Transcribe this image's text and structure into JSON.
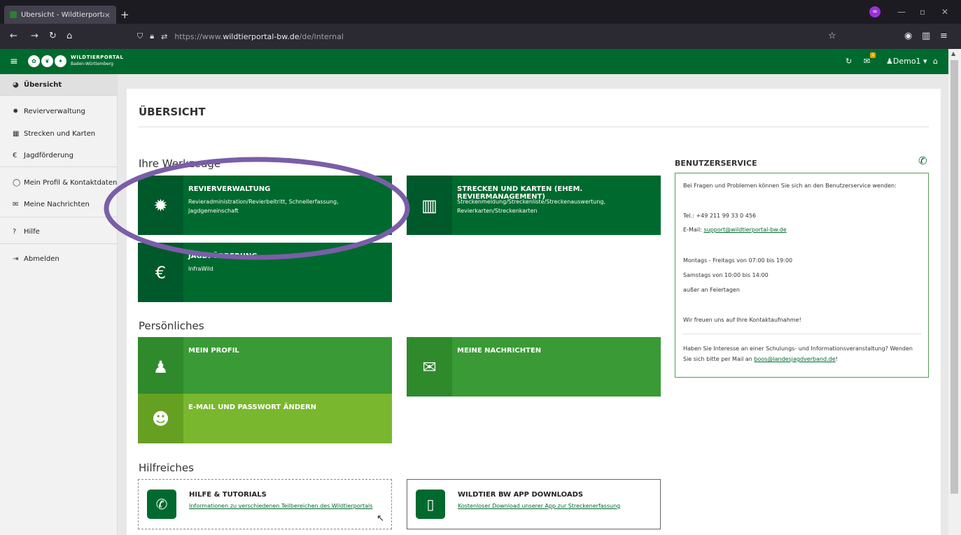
{
  "browser": {
    "tab_title": "Übersicht - Wildtierportal",
    "tab_close": "×",
    "new_tab": "+",
    "url_dim_prefix": "https://www.",
    "url_domain": "wildtierportal-bw.de",
    "url_path": "/de/internal",
    "private_icon": "∞"
  },
  "header": {
    "logo_line1": "WILDTIERPORTAL",
    "logo_line2": "Baden-Württemberg",
    "notif_count": "1",
    "user": "Demo1"
  },
  "sidebar": {
    "items": [
      {
        "label": "Übersicht",
        "icon": "dashboard-icon"
      },
      {
        "label": "Revierverwaltung",
        "icon": "gear-icon"
      },
      {
        "label": "Strecken und Karten",
        "icon": "map-icon"
      },
      {
        "label": "Jagdförderung",
        "icon": "euro-icon"
      },
      {
        "label": "Mein Profil & Kontaktdaten",
        "icon": "user-circle-icon"
      },
      {
        "label": "Meine Nachrichten",
        "icon": "envelope-icon"
      },
      {
        "label": "Hilfe",
        "icon": "question-icon"
      },
      {
        "label": "Abmelden",
        "icon": "sign-out-icon"
      }
    ]
  },
  "main": {
    "title": "ÜBERSICHT",
    "sections": {
      "tools": "Ihre Werkzeuge",
      "personal": "Persönliches",
      "helpful": "Hilfreiches"
    },
    "tiles": [
      {
        "title": "REVIERVERWALTUNG",
        "subtitle": "Revieradministration/Revierbeitritt, Schnellerfassung, Jagdgemeinschaft"
      },
      {
        "title": "STRECKEN UND KARTEN (EHEM. REVIERMANAGEMENT)",
        "subtitle": "Streckenmeldung/Streckenliste/Streckenauswertung, Revierkarten/Streckenkarten"
      },
      {
        "title": "JAGDFÖRDERUNG",
        "subtitle": "InfraWild"
      },
      {
        "title": "MEIN PROFIL",
        "subtitle": ""
      },
      {
        "title": "MEINE NACHRICHTEN",
        "subtitle": ""
      },
      {
        "title": "E-MAIL UND PASSWORT ÄNDERN",
        "subtitle": ""
      }
    ],
    "help_tiles": [
      {
        "title": "HILFE & TUTORIALS",
        "link": "Informationen zu verschiedenen Teilbereichen des Wildtierportals"
      },
      {
        "title": "WILDTIER BW APP DOWNLOADS",
        "link": "Kostenloser Download unserer App zur Streckenerfassung"
      }
    ]
  },
  "service": {
    "title": "BENUTZERSERVICE",
    "intro": "Bei Fragen und Problemen können Sie sich an den Benutzerservice wenden:",
    "tel": "Tel.: +49 211 99 33 0 456",
    "email_label": "E-Mail: ",
    "email": "support@wildtierportal-bw.de",
    "hours1": "Montags - Freitags von 07:00 bis 19:00",
    "hours2": "Samstags von 10:00 bis 14:00",
    "hours3": "außer an Feiertagen",
    "thanks": "Wir freuen uns auf Ihre Kontaktaufnahme!",
    "event_text1": "Haben Sie Interesse an einer Schulungs- und Informationsveranstaltung? Wenden",
    "event_text2": "Sie sich bitte per Mail an ",
    "event_email": "boos@landesjagdverband.de",
    "event_end": "!"
  },
  "colors": {
    "brand": "#006a2e",
    "mid": "#3a9a35",
    "light": "#79b72e",
    "annotation": "#7a5ea8"
  }
}
